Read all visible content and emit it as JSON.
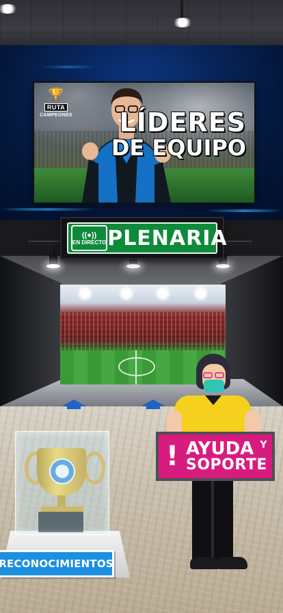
{
  "billboard": {
    "logo_top": "RUTA",
    "logo_bottom": "CAMPEONES",
    "title_line1": "LÍDERES",
    "title_line2": "DE EQUIPO"
  },
  "sign": {
    "live_label": "EN DIRECTO",
    "title": "PLENARIA"
  },
  "help": {
    "line1_main": "AYUDA",
    "line1_small": "Y",
    "line2": "SOPORTE",
    "icon_glyph": "!"
  },
  "recognitions": {
    "label": "RECONOCIMIENTOS"
  },
  "colors": {
    "sign_green": "#0e8a3b",
    "help_pink": "#d81b7e",
    "recog_blue": "#1b8fe0"
  }
}
